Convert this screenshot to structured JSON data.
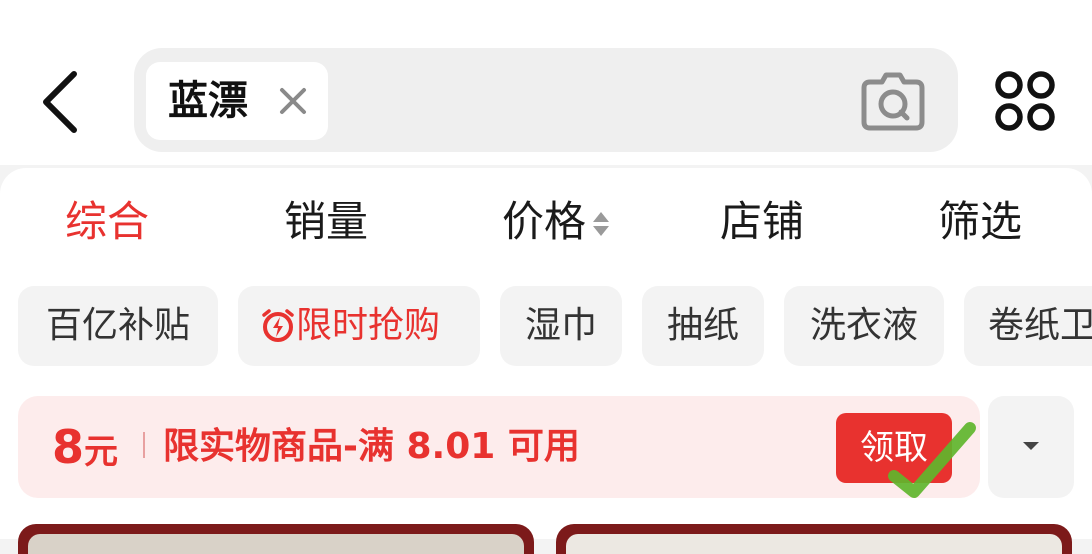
{
  "header": {
    "search_chip": "蓝漂",
    "icons": [
      "back-icon",
      "close-icon",
      "camera-icon",
      "grid-icon"
    ]
  },
  "sort_tabs": [
    {
      "label": "综合",
      "active": true
    },
    {
      "label": "销量",
      "active": false
    },
    {
      "label": "价格",
      "active": false
    },
    {
      "label": "店铺",
      "active": false
    },
    {
      "label": "筛选",
      "active": false
    }
  ],
  "tags": [
    {
      "label": "百亿补贴"
    },
    {
      "label": "限时抢购",
      "icon": "alarm-flash-icon"
    },
    {
      "label": "湿巾"
    },
    {
      "label": "抽纸"
    },
    {
      "label": "洗衣液"
    },
    {
      "label": "卷纸卫"
    }
  ],
  "coupon": {
    "amount": "8",
    "unit": "元",
    "description": "限实物商品-满 8.01 可用",
    "claim_label": "领取"
  },
  "colors": {
    "accent": "#e8322f",
    "coupon_bg": "#fdecec",
    "chip_bg": "#f3f3f3"
  }
}
